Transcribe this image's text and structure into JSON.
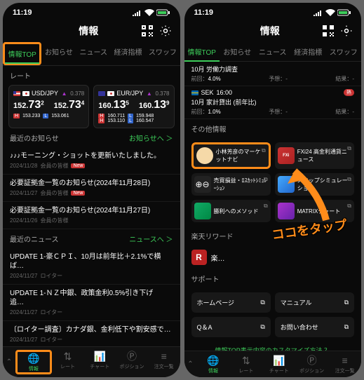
{
  "status": {
    "time": "11:19"
  },
  "header": {
    "title": "情報"
  },
  "tabs": [
    {
      "label": "情報TOP",
      "active": true
    },
    {
      "label": "お知らせ"
    },
    {
      "label": "ニュース"
    },
    {
      "label": "経済指標"
    },
    {
      "label": "スワッフ"
    }
  ],
  "sections": {
    "rates_label": "レート",
    "notices_label": "最近のお知らせ",
    "notices_link": "お知らせへ ＞",
    "news_label": "最近のニュース",
    "news_link": "ニュースへ ＞",
    "other_label": "その他情報",
    "reward_label": "楽天リワード",
    "support_label": "サポート"
  },
  "rates": [
    {
      "pair": "USD/JPY",
      "spread": "0.378",
      "bid_main": "152.",
      "bid_big": "73",
      "bid_sup": "2",
      "ask_main": "152.",
      "ask_big": "73",
      "ask_sup": "4",
      "hi": "153.233",
      "lo": "153.061"
    },
    {
      "pair": "EUR/JPY",
      "spread": "0.378",
      "bid_main": "160.",
      "bid_big": "13",
      "bid_sup": "5",
      "ask_main": "160.",
      "ask_big": "13",
      "ask_sup": "9",
      "hi": "160.711",
      "lo": "159.948"
    },
    {
      "pair": "EUR/JPY",
      "spread": "0.378",
      "bid_main": "160.",
      "bid_big": "13",
      "bid_sup": "5",
      "ask_main": "160.",
      "ask_big": "13",
      "ask_sup": "9",
      "hi": "153.110",
      "lo": "160.547"
    }
  ],
  "notices": [
    {
      "title": "♪♪♪モーニング・ショットを更新いたしました。",
      "date": "2024/11/28",
      "sub": "会員の皆様",
      "isNew": true
    },
    {
      "title": "必要証拠金一覧のお知らせ(2024年11月28日)",
      "date": "2024/11/27",
      "sub": "会員の皆様",
      "isNew": true
    },
    {
      "title": "必要証拠金一覧のお知らせ(2024年11月27日)",
      "date": "2024/11/26",
      "sub": "会員の皆様",
      "isNew": false
    }
  ],
  "news": [
    {
      "title": "UPDATE 1-豪ＣＰＩ、10月は前年比＋2.1%で横ば…",
      "date": "2024/11/27",
      "src": "ロイター"
    },
    {
      "title": "UPDATE 1-ＮＺ中銀、政策金利0.5%引き下げ　追…",
      "date": "2024/11/27",
      "src": "ロイター"
    },
    {
      "title": "〔ロイター調査〕カナダ銀、金利低下や割安感で…",
      "date": "2024/11/27",
      "src": "ロイター"
    }
  ],
  "econ": [
    {
      "head": "10月 労働力調査",
      "prev_lbl": "前回：",
      "prev": "4.0%",
      "fc_lbl": "予想：",
      "fc": "-",
      "res_lbl": "結果：",
      "res": "-"
    },
    {
      "flag": "se",
      "code": "SEK",
      "time": "16:00",
      "head": "10月 家計貸出 (前年比)",
      "prev_lbl": "前回：",
      "prev": "1.0%",
      "fc_lbl": "予想：",
      "fc": "-",
      "res_lbl": "結果：",
      "res": "-",
      "hot": "熱"
    }
  ],
  "tools": [
    {
      "title": "小林芳彦のマーケットナビ",
      "color": "#f5d9a8"
    },
    {
      "title": "FXi24 高金利通貨ニュース",
      "color": "#c33"
    },
    {
      "title": "売買損益・ﾛｽｶｯﾄｼﾐｭﾚｰｼｮﾝ",
      "color": "#222"
    },
    {
      "title": "スワップシミュレーション",
      "color": "#4a88ff"
    },
    {
      "title": "勝利へのメソッド",
      "color": "#1a6"
    },
    {
      "title": "MATRIXチャート",
      "color": "#a3c"
    }
  ],
  "reward": {
    "text": "楽…"
  },
  "support": [
    {
      "label": "ホームページ"
    },
    {
      "label": "マニュアル"
    },
    {
      "label": "Q＆A"
    },
    {
      "label": "お問い合わせ"
    }
  ],
  "custom_link": "情報TOP表示内容のカスタマイズ方法 ？",
  "nav": [
    {
      "label": "情報",
      "active": true
    },
    {
      "label": "レート"
    },
    {
      "label": "チャート"
    },
    {
      "label": "ポジション"
    },
    {
      "label": "注文一覧"
    }
  ],
  "annot": {
    "text": "ココをタップ"
  }
}
